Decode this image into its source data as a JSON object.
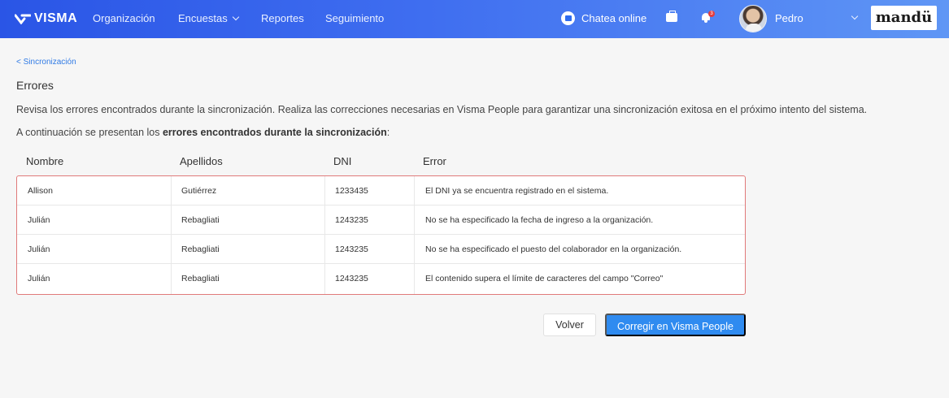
{
  "nav": {
    "brand": "VISMA",
    "items": [
      "Organización",
      "Encuestas",
      "Reportes",
      "Seguimiento"
    ],
    "chat_label": "Chatea online",
    "notifications_count": "3",
    "user_name": "Pedro",
    "client_brand": "mandü"
  },
  "breadcrumb": "< Sincronización",
  "title": "Errores",
  "description": "Revisa los errores encontrados durante la sincronización. Realiza las correcciones necesarias en Visma People para garantizar una sincronización exitosa en el próximo intento del sistema.",
  "intro": {
    "prefix": "A continuación se presentan los ",
    "bold": "errores encontrados durante la sincronización",
    "suffix": ":"
  },
  "table": {
    "headers": [
      "Nombre",
      "Apellidos",
      "DNI",
      "Error"
    ],
    "rows": [
      [
        "Allison",
        "Gutiérrez",
        "1233435",
        "El DNI ya se encuentra registrado en el sistema."
      ],
      [
        "Julián",
        "Rebagliati",
        "1243235",
        "No se ha especificado la fecha de ingreso a la organización."
      ],
      [
        "Julián",
        "Rebagliati",
        "1243235",
        "No se ha especificado el puesto del colaborador en la organización."
      ],
      [
        "Julián",
        "Rebagliati",
        "1243235",
        "El contenido supera el límite de caracteres del campo \"Correo\""
      ]
    ]
  },
  "buttons": {
    "back": "Volver",
    "fix": "Corregir en Visma People"
  },
  "colors": {
    "nav_start": "#2a55e6",
    "nav_end": "#5f96f5",
    "primary_button": "#2f8bf0",
    "error_border": "#e07a7a",
    "link": "#2f7ae5"
  }
}
